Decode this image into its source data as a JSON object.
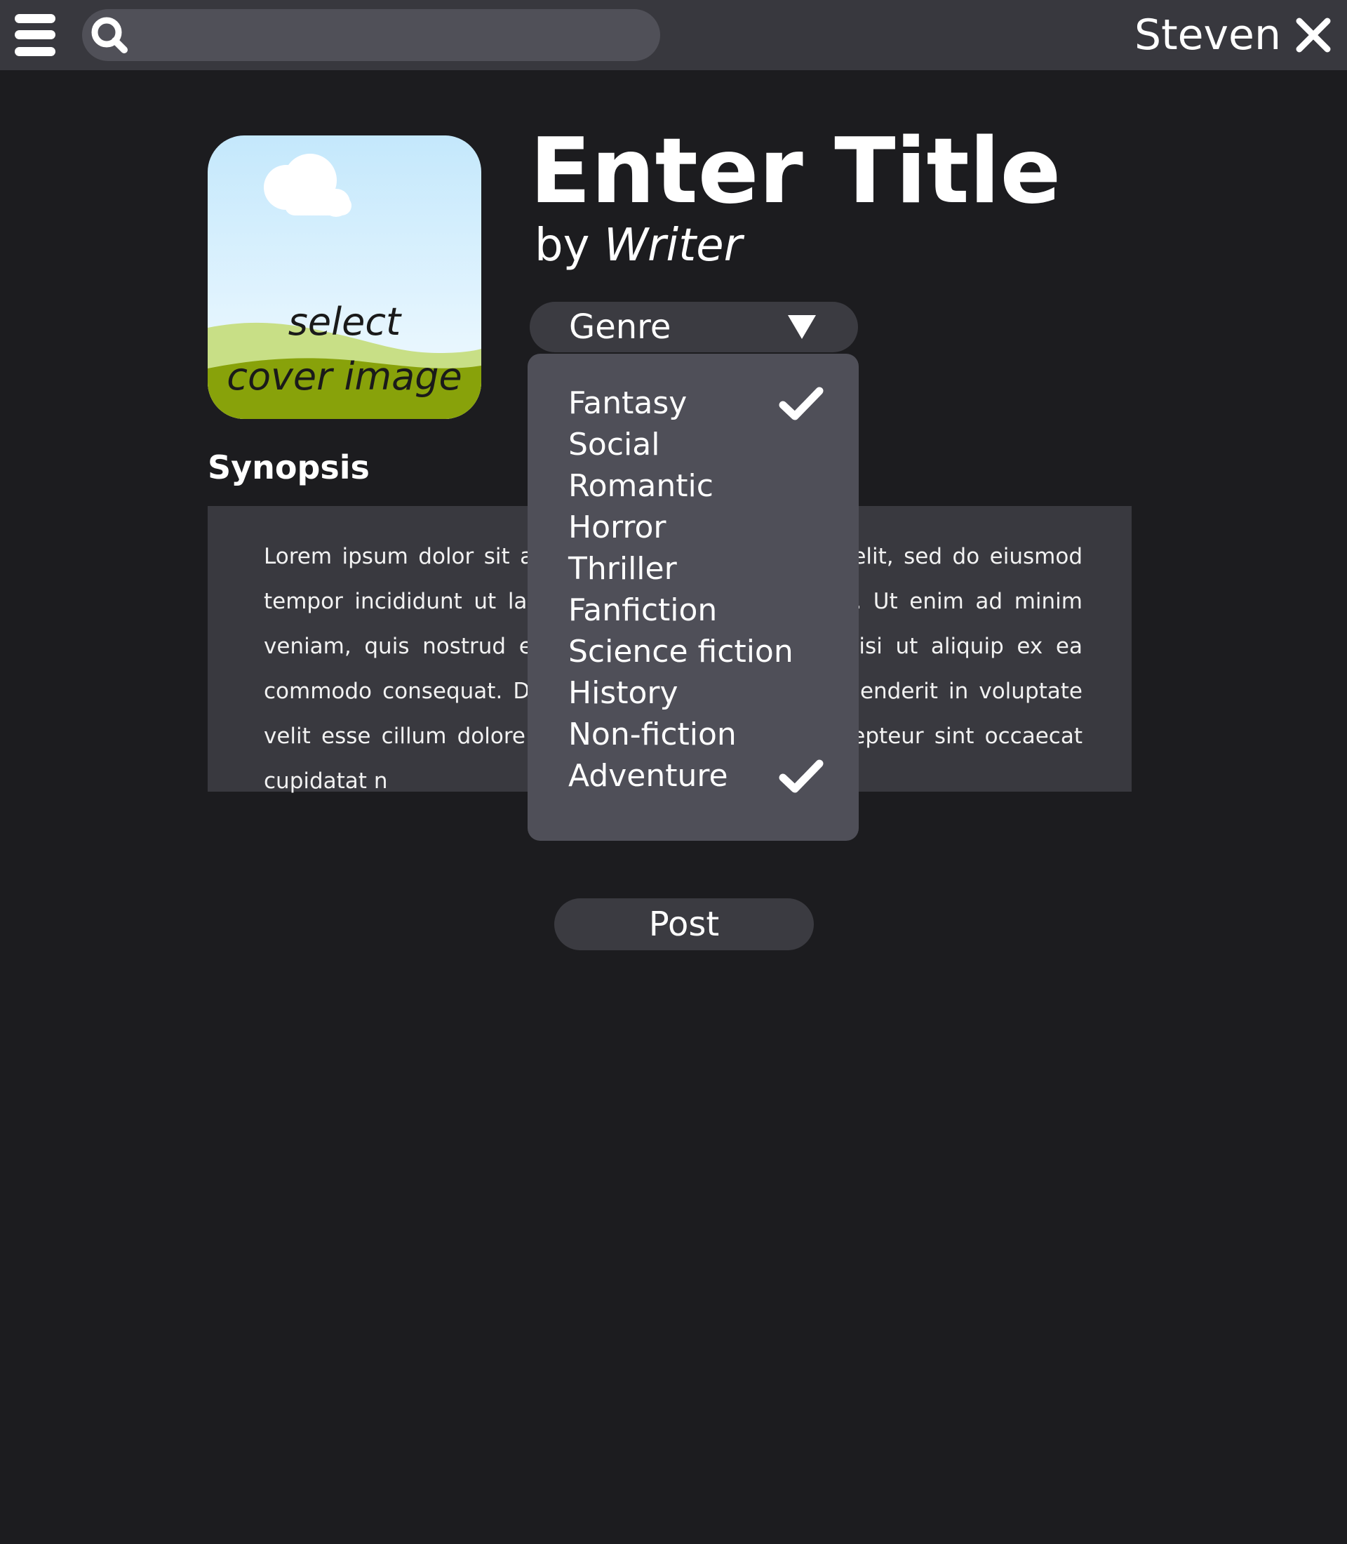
{
  "header": {
    "search": {
      "value": "",
      "placeholder": ""
    },
    "username": "Steven"
  },
  "cover": {
    "line1": "select",
    "line2": "cover image"
  },
  "story": {
    "title": "Enter Title",
    "by": "by",
    "writer": "Writer"
  },
  "genre": {
    "label": "Genre",
    "options": [
      {
        "label": "Fantasy",
        "checked": true
      },
      {
        "label": "Social",
        "checked": false
      },
      {
        "label": "Romantic",
        "checked": false
      },
      {
        "label": "Horror",
        "checked": false
      },
      {
        "label": "Thriller",
        "checked": false
      },
      {
        "label": "Fanfiction",
        "checked": false
      },
      {
        "label": "Science fiction",
        "checked": false
      },
      {
        "label": "History",
        "checked": false
      },
      {
        "label": "Non-fiction",
        "checked": false
      },
      {
        "label": "Adventure",
        "checked": true
      }
    ]
  },
  "synopsis": {
    "heading": "Synopsis",
    "text": "Lorem ipsum dolor sit amet, consectetur adipiscing elit, sed do eiusmod tempor incididunt ut labore et dolore magna aliqua. Ut enim ad minim veniam, quis nostrud exercitation ullamco laboris nisi ut aliquip ex ea commodo consequat. Duis aute irure dolor in reprehenderit in voluptate velit esse cillum dolore eu fugiat nulla pariatur. Excepteur sint occaecat cupidatat n"
  },
  "actions": {
    "post_label": "Post"
  },
  "colors": {
    "background": "#1c1c1f",
    "topbar": "#38383e",
    "search_field": "#505058",
    "dropdown_menu": "#4f4f58",
    "control": "#3b3b41",
    "synopsis_panel": "#39393f",
    "text": "#ffffff"
  }
}
